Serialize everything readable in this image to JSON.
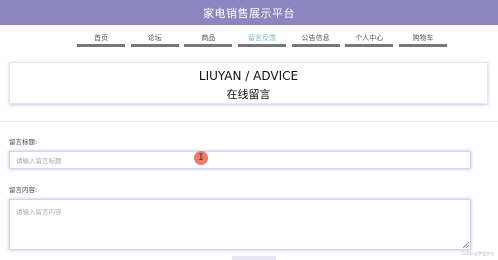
{
  "header": {
    "site_title": "家电销售展示平台"
  },
  "nav": {
    "items": [
      {
        "label": "首页"
      },
      {
        "label": "论坛"
      },
      {
        "label": "商品"
      },
      {
        "label": "留言反馈"
      },
      {
        "label": "公告信息"
      },
      {
        "label": "个人中心"
      },
      {
        "label": "购物车"
      }
    ],
    "active_index": 3
  },
  "page_header": {
    "title_en": "LIUYAN / ADVICE",
    "title_cn": "在线留言"
  },
  "form": {
    "title_label": "留言标题:",
    "title_placeholder": "请输入留言标题",
    "content_label": "留言内容:",
    "content_placeholder": "请输入留言内容"
  },
  "watermark": "CSDN @梦里逆光",
  "colors": {
    "topbar": "#8c86be",
    "nav_underline": "#777777",
    "nav_active": "#7fb4d4",
    "cursor_marker": "#f07a6b"
  },
  "icons": {
    "cursor": "text-cursor-icon"
  }
}
